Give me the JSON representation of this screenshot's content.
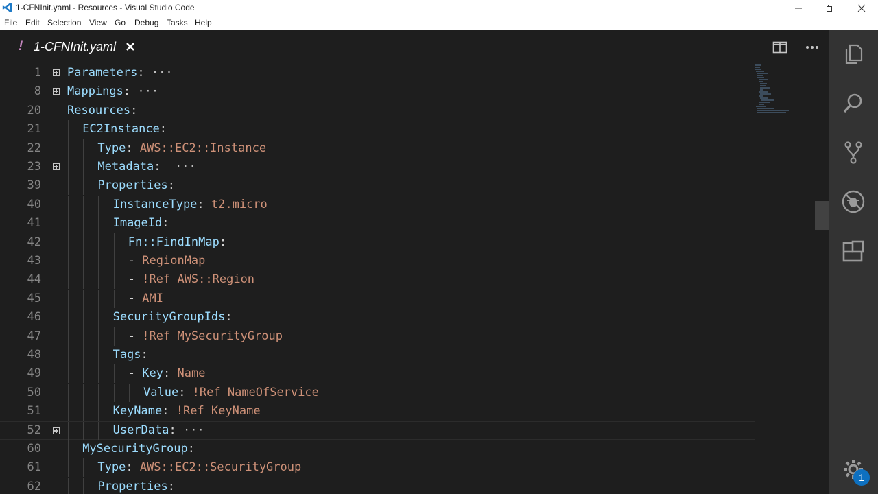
{
  "window": {
    "title": "1-CFNInit.yaml - Resources - Visual Studio Code"
  },
  "menu": [
    "File",
    "Edit",
    "Selection",
    "View",
    "Go",
    "Debug",
    "Tasks",
    "Help"
  ],
  "tab": {
    "modified_marker": "!",
    "label": "1-CFNInit.yaml"
  },
  "editor": {
    "lines": [
      {
        "n": "1",
        "indent": 0,
        "fold": true,
        "tokens": [
          {
            "t": "k",
            "s": "Parameters"
          },
          {
            "t": "p",
            "s": ":"
          },
          {
            "t": "e",
            "s": " ···"
          }
        ]
      },
      {
        "n": "8",
        "indent": 0,
        "fold": true,
        "tokens": [
          {
            "t": "k",
            "s": "Mappings"
          },
          {
            "t": "p",
            "s": ":"
          },
          {
            "t": "e",
            "s": " ···"
          }
        ]
      },
      {
        "n": "20",
        "indent": 0,
        "fold": false,
        "tokens": [
          {
            "t": "k",
            "s": "Resources"
          },
          {
            "t": "p",
            "s": ":"
          }
        ]
      },
      {
        "n": "21",
        "indent": 1,
        "fold": false,
        "tokens": [
          {
            "t": "k",
            "s": "EC2Instance"
          },
          {
            "t": "p",
            "s": ":"
          }
        ]
      },
      {
        "n": "22",
        "indent": 2,
        "fold": false,
        "tokens": [
          {
            "t": "k",
            "s": "Type"
          },
          {
            "t": "p",
            "s": ": "
          },
          {
            "t": "v",
            "s": "AWS::EC2::Instance"
          }
        ]
      },
      {
        "n": "23",
        "indent": 2,
        "fold": true,
        "tokens": [
          {
            "t": "k",
            "s": "Metadata"
          },
          {
            "t": "p",
            "s": ":"
          },
          {
            "t": "e",
            "s": "  ···"
          }
        ]
      },
      {
        "n": "39",
        "indent": 2,
        "fold": false,
        "tokens": [
          {
            "t": "k",
            "s": "Properties"
          },
          {
            "t": "p",
            "s": ":"
          }
        ]
      },
      {
        "n": "40",
        "indent": 3,
        "fold": false,
        "tokens": [
          {
            "t": "k",
            "s": "InstanceType"
          },
          {
            "t": "p",
            "s": ": "
          },
          {
            "t": "v",
            "s": "t2.micro"
          }
        ]
      },
      {
        "n": "41",
        "indent": 3,
        "fold": false,
        "tokens": [
          {
            "t": "k",
            "s": "ImageId"
          },
          {
            "t": "p",
            "s": ":"
          }
        ]
      },
      {
        "n": "42",
        "indent": 4,
        "fold": false,
        "tokens": [
          {
            "t": "k",
            "s": "Fn::FindInMap"
          },
          {
            "t": "p",
            "s": ":"
          }
        ]
      },
      {
        "n": "43",
        "indent": 4,
        "fold": false,
        "tokens": [
          {
            "t": "p",
            "s": "- "
          },
          {
            "t": "v",
            "s": "RegionMap"
          }
        ]
      },
      {
        "n": "44",
        "indent": 4,
        "fold": false,
        "tokens": [
          {
            "t": "p",
            "s": "- "
          },
          {
            "t": "v",
            "s": "!Ref AWS::Region"
          }
        ]
      },
      {
        "n": "45",
        "indent": 4,
        "fold": false,
        "tokens": [
          {
            "t": "p",
            "s": "- "
          },
          {
            "t": "v",
            "s": "AMI"
          }
        ]
      },
      {
        "n": "46",
        "indent": 3,
        "fold": false,
        "tokens": [
          {
            "t": "k",
            "s": "SecurityGroupIds"
          },
          {
            "t": "p",
            "s": ":"
          }
        ]
      },
      {
        "n": "47",
        "indent": 4,
        "fold": false,
        "tokens": [
          {
            "t": "p",
            "s": "- "
          },
          {
            "t": "v",
            "s": "!Ref MySecurityGroup"
          }
        ]
      },
      {
        "n": "48",
        "indent": 3,
        "fold": false,
        "tokens": [
          {
            "t": "k",
            "s": "Tags"
          },
          {
            "t": "p",
            "s": ":"
          }
        ]
      },
      {
        "n": "49",
        "indent": 4,
        "fold": false,
        "tokens": [
          {
            "t": "p",
            "s": "- "
          },
          {
            "t": "k",
            "s": "Key"
          },
          {
            "t": "p",
            "s": ": "
          },
          {
            "t": "v",
            "s": "Name"
          }
        ]
      },
      {
        "n": "50",
        "indent": 5,
        "fold": false,
        "tokens": [
          {
            "t": "k",
            "s": "Value"
          },
          {
            "t": "p",
            "s": ": "
          },
          {
            "t": "v",
            "s": "!Ref NameOfService"
          }
        ]
      },
      {
        "n": "51",
        "indent": 3,
        "fold": false,
        "tokens": [
          {
            "t": "k",
            "s": "KeyName"
          },
          {
            "t": "p",
            "s": ": "
          },
          {
            "t": "v",
            "s": "!Ref KeyName"
          }
        ]
      },
      {
        "n": "52",
        "indent": 3,
        "fold": true,
        "current": true,
        "tokens": [
          {
            "t": "k",
            "s": "UserData"
          },
          {
            "t": "p",
            "s": ":"
          },
          {
            "t": "e",
            "s": " ···"
          }
        ]
      },
      {
        "n": "60",
        "indent": 1,
        "fold": false,
        "tokens": [
          {
            "t": "k",
            "s": "MySecurityGroup"
          },
          {
            "t": "p",
            "s": ":"
          }
        ]
      },
      {
        "n": "61",
        "indent": 2,
        "fold": false,
        "tokens": [
          {
            "t": "k",
            "s": "Type"
          },
          {
            "t": "p",
            "s": ": "
          },
          {
            "t": "v",
            "s": "AWS::EC2::SecurityGroup"
          }
        ]
      },
      {
        "n": "62",
        "indent": 2,
        "fold": false,
        "tokens": [
          {
            "t": "k",
            "s": "Properties"
          },
          {
            "t": "p",
            "s": ":"
          }
        ]
      }
    ]
  },
  "activity_bar": {
    "icons": [
      "explorer-icon",
      "search-icon",
      "source-control-icon",
      "debug-icon",
      "extensions-icon"
    ],
    "settings_badge": "1"
  },
  "colors": {
    "key": "#9cdcfe",
    "value": "#ce9178",
    "modified": "#c586c0",
    "badge": "#0e70c0"
  }
}
